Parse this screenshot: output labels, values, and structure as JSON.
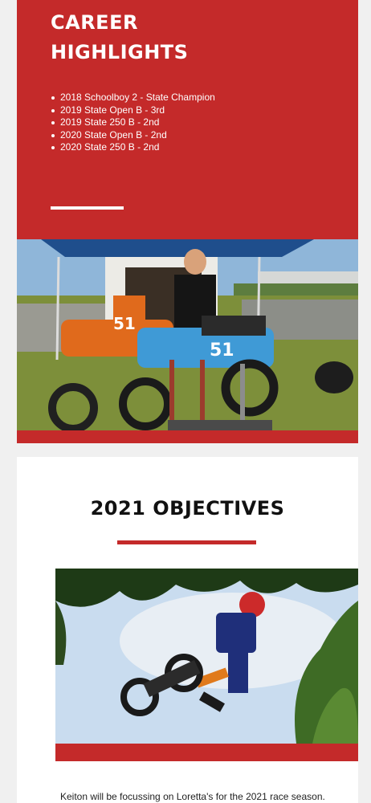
{
  "career": {
    "title_line1": "CAREER",
    "title_line2": "HIGHLIGHTS",
    "highlights": [
      "2018 Schoolboy 2 - State Champion",
      "2019 State Open B - 3rd",
      "2019 State 250 B - 2nd",
      "2020 State Open B - 2nd",
      "2020 State 250 B - 2nd"
    ]
  },
  "photo1": {
    "bike_left_number": "51",
    "bike_right_number": "51"
  },
  "objectives": {
    "title": "2021 OBJECTIVES",
    "body": "Keiton will be focussing on Loretta's for the 2021 race season."
  },
  "colors": {
    "accent_red": "#c42a2a",
    "page_bg": "#f0f0f0",
    "card_bg": "#ffffff"
  }
}
